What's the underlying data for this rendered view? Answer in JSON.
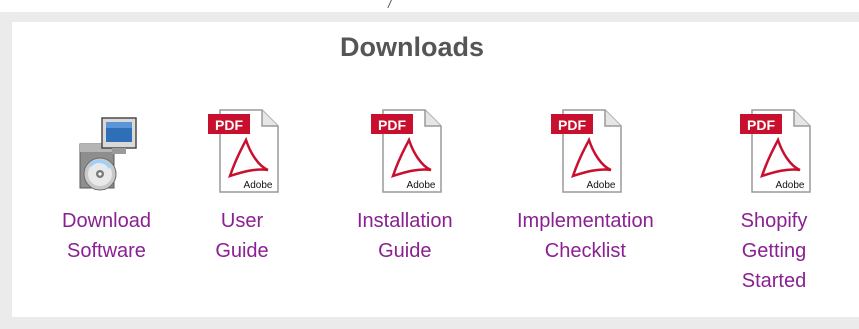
{
  "page": {
    "top_glyph": "/"
  },
  "downloads": {
    "title": "Downloads",
    "items": [
      {
        "id": "download-software",
        "icon": "software-installer-icon",
        "lines": [
          "Download",
          "Software"
        ]
      },
      {
        "id": "user-guide",
        "icon": "pdf-icon",
        "lines": [
          "User",
          "Guide"
        ]
      },
      {
        "id": "installation-guide",
        "icon": "pdf-icon",
        "lines": [
          "Installation",
          "Guide"
        ]
      },
      {
        "id": "implementation-checklist",
        "icon": "pdf-icon",
        "lines": [
          "Implementation",
          "Checklist"
        ]
      },
      {
        "id": "shopify-getting-started",
        "icon": "pdf-icon",
        "lines": [
          "Shopify",
          "Getting",
          "Started"
        ]
      }
    ],
    "pdf_badge": "PDF",
    "pdf_brand": "Adobe"
  },
  "colors": {
    "link": "#8a2092",
    "title": "#555555",
    "background": "#ebebeb",
    "panel": "#ffffff",
    "pdf_red": "#c8102e"
  }
}
